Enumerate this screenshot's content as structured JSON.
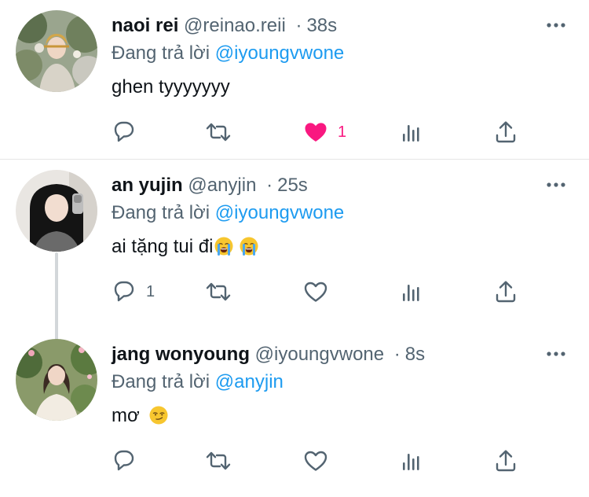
{
  "colors": {
    "text": "#0f1419",
    "muted": "#536471",
    "mention": "#1d9bf0",
    "like": "#f91880",
    "divider": "#e6e6e6",
    "thread": "#d3d7da"
  },
  "tweets": [
    {
      "name": "naoi rei",
      "handle": "@reinao.reii",
      "separator": "·",
      "time": "38s",
      "reply_prefix": "Đang trả lời",
      "reply_to": "@iyoungvwone",
      "text": "ghen tyyyyyyy",
      "emojis": [],
      "reply_count": "",
      "retweet_count": "",
      "like_count": "1",
      "liked": true
    },
    {
      "name": "an yujin",
      "handle": "@anyjin",
      "separator": "·",
      "time": "25s",
      "reply_prefix": "Đang trả lời",
      "reply_to": "@iyoungvwone",
      "text": "ai tặng tui đi",
      "emojis": [
        "loudly-crying-face",
        "loudly-crying-face"
      ],
      "reply_count": "1",
      "retweet_count": "",
      "like_count": "",
      "liked": false
    },
    {
      "name": "jang wonyoung",
      "handle": "@iyoungvwone",
      "separator": "·",
      "time": "8s",
      "reply_prefix": "Đang trả lời",
      "reply_to": "@anyjin",
      "text": "mơ",
      "emojis": [
        "smirking-face"
      ],
      "reply_count": "",
      "retweet_count": "",
      "like_count": "",
      "liked": false
    }
  ]
}
